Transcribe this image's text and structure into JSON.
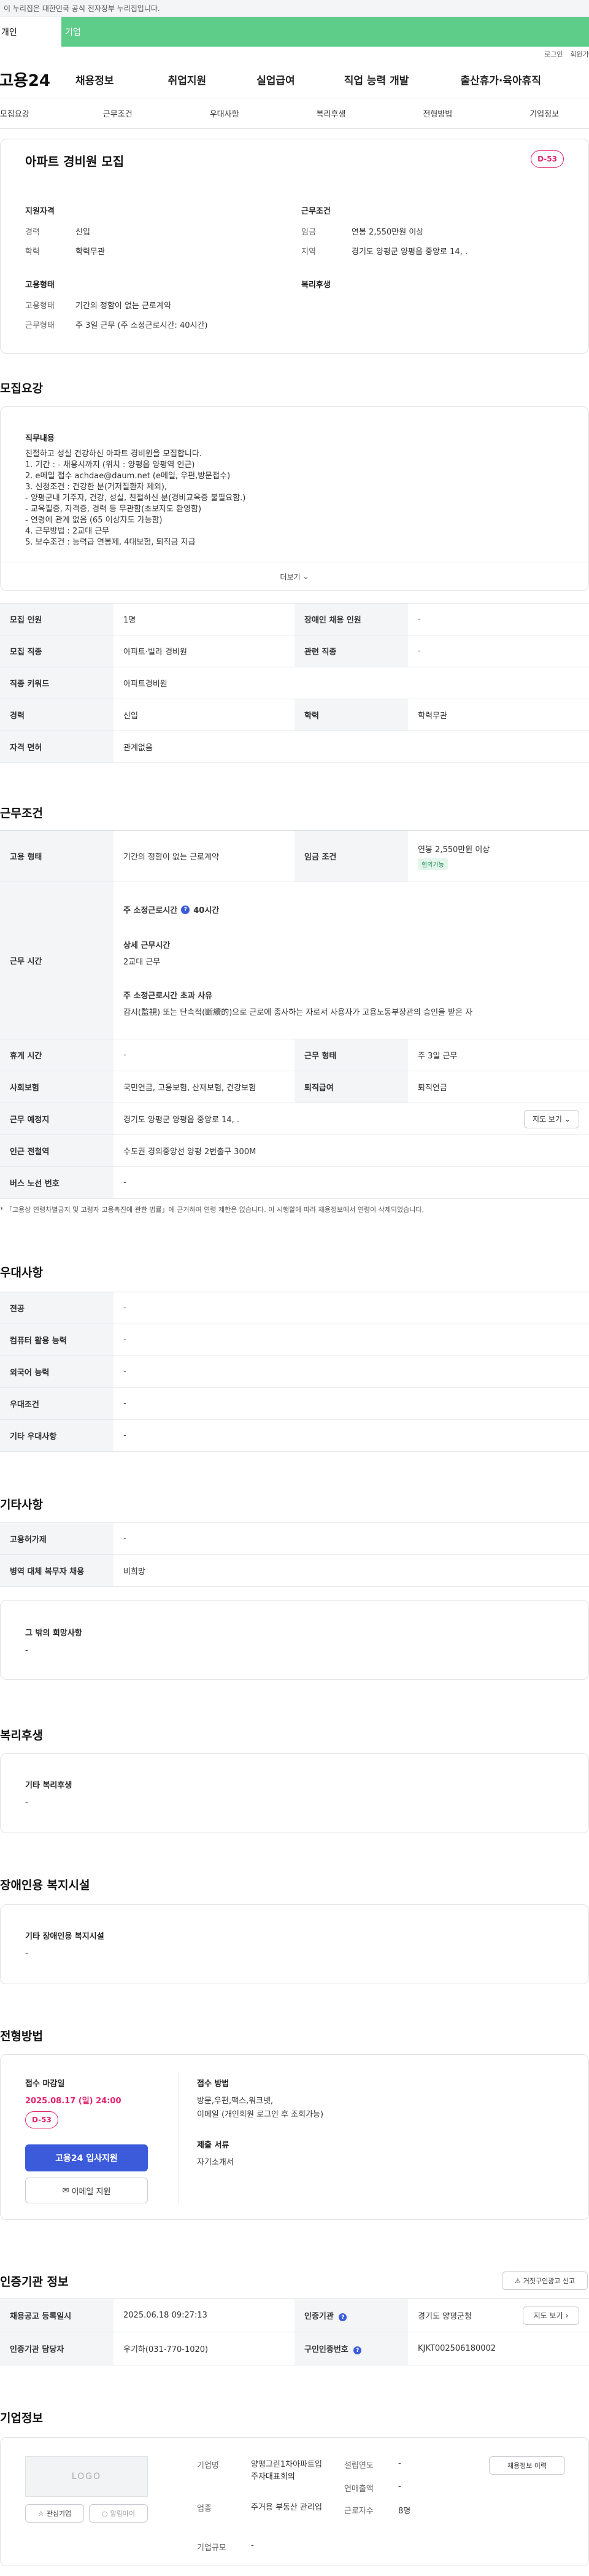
{
  "gov_banner": {
    "text": "이 누리집은 대한민국 공식 전자정부 누리집입니다."
  },
  "top_tabs": [
    "개인",
    "기업"
  ],
  "util_links": [
    "로그인",
    "회원가입"
  ],
  "gnb": {
    "logo": "고용24",
    "items": [
      "채용정보",
      "취업지원",
      "실업급여",
      "직업 능력 개발",
      "출산휴가·육아휴직"
    ]
  },
  "snb": [
    "모집요강",
    "근무조건",
    "우대사항",
    "복리후생",
    "전형방법",
    "기업정보"
  ],
  "job": {
    "title": "아파트 경비원 모집",
    "dday": "D-53",
    "qual_title": "지원자격",
    "career_label": "경력",
    "career_value": "신입",
    "edu_label": "학력",
    "edu_value": "학력무관",
    "cond_title": "근무조건",
    "wage_label": "임금",
    "wage_value": "연봉 2,550만원 이상",
    "region_label": "지역",
    "region_value": "경기도 양평군 양평읍 중앙로 14, .",
    "emp_title": "고용형태",
    "emp_type_label": "고용형태",
    "emp_type_value": "기간의 정함이 없는 근로계약",
    "work_type_label": "근무형태",
    "work_type_value": "주 3일 근무 (주 소정근로시간: 40시간)",
    "welfare_title": "복리후생"
  },
  "recruit": {
    "section_title": "모집요강",
    "duty_title": "직무내용",
    "duty_lines": [
      "친절하고 성실 건강하신 아파트 경비원을 모집합니다.",
      "1. 기간 : - 채용시까지 (위치 : 양평읍 양평역 인근)",
      "2. e메일 접수  achdae@daum.net   (e메일, 우편,방문접수)",
      "3. 신청조건 : 건강한 분(거저질환자 제외),",
      "- 양평군내 거주자, 건강, 성실, 친절하신 분(경비교육증 불필요함.)",
      "- 교육필증, 자격증, 경력 등 무관함(초보자도 환영함)",
      "- 연령에 관계 없음 (65 이상자도 가능함)",
      "4. 근무방법 : 2교대 근무",
      "5. 보수조건 : 능력급 연봉제, 4대보험,  퇴직금 지급"
    ],
    "more_label": "더보기",
    "rows": [
      {
        "h1": "모집 인원",
        "v1": "1명",
        "h2": "장애인 채용 인원",
        "v2": "-"
      },
      {
        "h1": "모집 직종",
        "v1": "아파트·빌라 경비원",
        "h2": "관련 직종",
        "v2": "-"
      },
      {
        "h1": "직종 키워드",
        "v1": "아파트경비원"
      },
      {
        "h1": "경력",
        "v1": "신입",
        "h2": "학력",
        "v2": "학력무관"
      },
      {
        "h1": "자격 면허",
        "v1": "관계없음"
      }
    ]
  },
  "conditions": {
    "section_title": "근무조건",
    "emp_h": "고용 형태",
    "emp_v": "기간의 정함이 없는 근로계약",
    "wage_h": "임금 조건",
    "wage_v": "연봉 2,550만원 이상",
    "wage_badge": "협의가능",
    "hours_h": "근무 시간",
    "hours_title": "주 소정근로시간",
    "hours_value": "40시간",
    "detail_title": "상세 근무시간",
    "detail_value": "2교대 근무",
    "over_title": "주 소정근로시간 초과 사유",
    "over_value": "감시(監視) 또는 단속적(斷續的)으로 근로에 종사하는 자로서 사용자가 고용노동부장관의 승인을 받은 자",
    "break_h": "휴게 시간",
    "break_v": "-",
    "worktype_h": "근무 형태",
    "worktype_v": "주 3일 근무",
    "insurance_h": "사회보험",
    "insurance_v": "국민연금, 고용보험, 산재보험, 건강보험",
    "severance_h": "퇴직급여",
    "severance_v": "퇴직연금",
    "place_h": "근무 예정지",
    "place_v": "경기도 양평군 양평읍 중앙로 14, .",
    "map_label": "지도 보기",
    "station_h": "인근 전철역",
    "station_v": "수도권 경의중앙선 양평 2번출구 300M",
    "bus_h": "버스 노선 번호",
    "bus_v": "-",
    "note": "* 「고용상 연령차별금지 및 고령자 고용촉진에 관한 법률」에 근거하여 연령 제한은 없습니다. 이 시행할에 따라 채용정보에서 연령이 삭제되었습니다."
  },
  "preferred": {
    "section_title": "우대사항",
    "rows": [
      {
        "h": "전공",
        "v": "-"
      },
      {
        "h": "컴퓨터 활용 능력",
        "v": "-"
      },
      {
        "h": "외국어 능력",
        "v": "-"
      },
      {
        "h": "우대조건",
        "v": "-"
      },
      {
        "h": "기타 우대사항",
        "v": "-"
      }
    ]
  },
  "other": {
    "section_title": "기타사항",
    "rows": [
      {
        "h": "고용허가제",
        "v": "-"
      },
      {
        "h": "병역 대체 복무자 채용",
        "v": "비희망"
      }
    ],
    "wish_title": "그 밖의 희망사항",
    "wish_value": "-"
  },
  "welfare": {
    "section_title": "복리후생",
    "box_title": "기타 복리후생",
    "box_value": "-"
  },
  "disability": {
    "section_title": "장애인용 복지시설",
    "box_title": "기타 장애인용 복지시설",
    "box_value": "-"
  },
  "process": {
    "section_title": "전형방법",
    "deadline_title": "접수 마감일",
    "deadline_value": "2025.08.17 (일) 24:00",
    "dday": "D-53",
    "apply_label": "고용24 입사지원",
    "email_label": "이메일 지원",
    "method_title": "접수 방법",
    "method_value": "방문,우편,팩스,워크넷,",
    "method_value2": "이메일 (개인회원 로그인 후 조회가능)",
    "docs_title": "제출 서류",
    "docs_value": "자기소개서"
  },
  "agency": {
    "section_title": "인증기관 정보",
    "report_label": "거짓구인광고 신고",
    "reg_h": "채용공고 등록일시",
    "reg_v": "2025.06.18 09:27:13",
    "org_h": "인증기관",
    "org_v": "경기도 양평군청",
    "map_label": "지도 보기",
    "staff_h": "인증기관 담당자",
    "staff_v": "우기하(031-770-1020)",
    "id_h": "구인인증번호",
    "id_v": "KJKT002506180002"
  },
  "company": {
    "section_title": "기업정보",
    "logo_text": "LOGO",
    "fav_label": "관심기업",
    "alert_label": "알림아이",
    "name_h": "기업명",
    "name_v": "양평그린1차아파트입주자대표회의",
    "industry_h": "업종",
    "industry_v": "주거용 부동산 관리업",
    "size_h": "기업규모",
    "size_v": "-",
    "founded_h": "설립연도",
    "founded_v": "-",
    "revenue_h": "연매출액",
    "revenue_v": "-",
    "staff_h": "근로자수",
    "staff_v": "8명",
    "jobs_label": "채용정보 이력"
  }
}
